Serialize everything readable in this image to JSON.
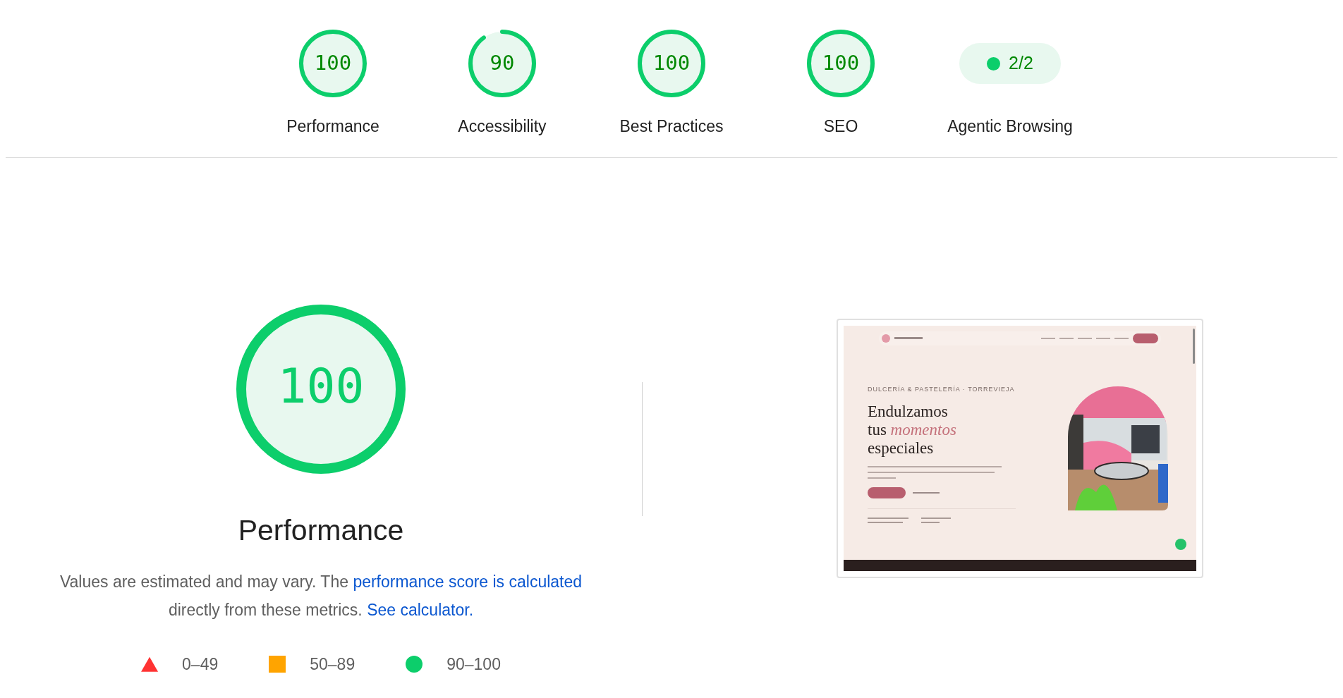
{
  "categories": [
    {
      "label": "Performance",
      "kind": "gauge",
      "score": "100"
    },
    {
      "label": "Accessibility",
      "kind": "gauge",
      "score": "90"
    },
    {
      "label": "Best Practices",
      "kind": "gauge",
      "score": "100"
    },
    {
      "label": "SEO",
      "kind": "gauge",
      "score": "100"
    },
    {
      "label": "Agentic Browsing",
      "kind": "fraction",
      "score": "2/2"
    }
  ],
  "summary": {
    "score": "100",
    "title": "Performance",
    "description": [
      {
        "text": "Values are estimated and may vary. The ",
        "link": false
      },
      {
        "text": "performance score is calculated",
        "link": true
      },
      {
        "text": " directly from these metrics. ",
        "link": false
      },
      {
        "text": "See calculator.",
        "link": true
      }
    ]
  },
  "legend": [
    {
      "kind": "fail",
      "range": "0–49"
    },
    {
      "kind": "average",
      "range": "50–89"
    },
    {
      "kind": "pass",
      "range": "90–100"
    }
  ],
  "screenshot": {
    "tagline": "DULCERÍA & PASTELERÍA · TORREVIEJA",
    "headline": "Endulzamos tus *momentos* especiales"
  }
}
